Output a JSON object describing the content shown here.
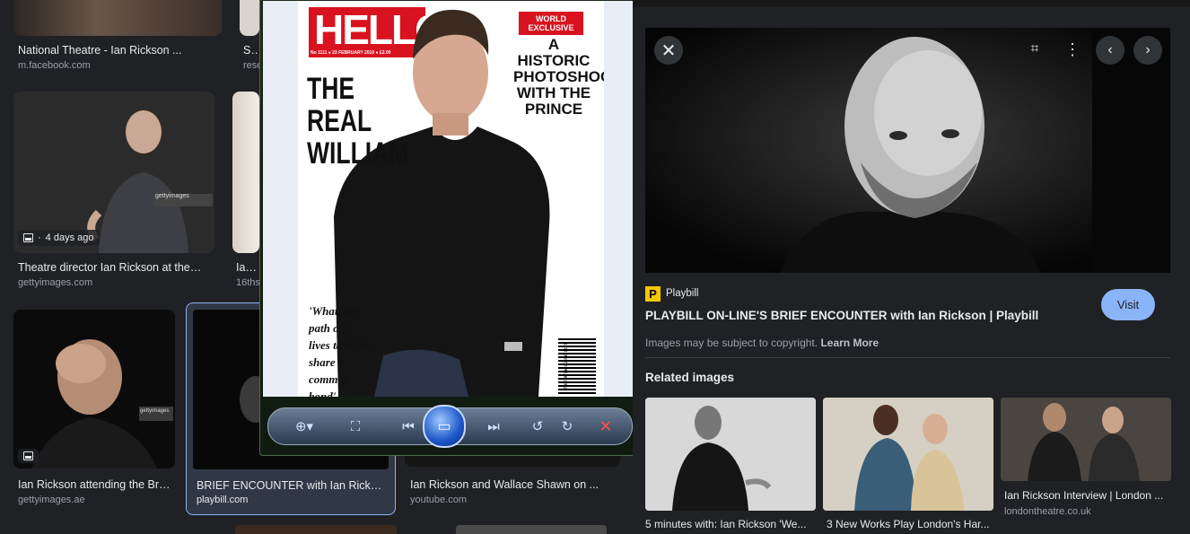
{
  "results": [
    {
      "title": "National Theatre - Ian Rickson ...",
      "source": "m.facebook.com"
    },
    {
      "title": "Sta",
      "source": "rese"
    },
    {
      "title": "Theatre director Ian Rickson at the ...",
      "source": "gettyimages.com",
      "badge": "4 days ago",
      "watermark": "gettyimages"
    },
    {
      "title": "Ian R",
      "source": "16ths"
    },
    {
      "title": "Ian Rickson attending the Bro...",
      "source": "gettyimages.ae",
      "watermark": "gettyimages"
    },
    {
      "title": "BRIEF ENCOUNTER with Ian Rickson...",
      "source": "playbill.com"
    },
    {
      "title": "Ian Rickson and Wallace Shawn on ...",
      "source": "youtube.com"
    }
  ],
  "viewer": {
    "magazine": {
      "masthead": "HELLO!",
      "issue": "No 1111 ● 23 FEBRUARY 2010 ● £2.00",
      "exclusive": "WORLD EXCLUSIVE",
      "headline": "THE REAL WILLIAM",
      "side_text": "A HISTORIC PHOTOSHOOT WITH THE PRINCE",
      "quote": "'Whatever path our lives take we share a common bond'",
      "barcode_text": "hellomagazine.com"
    }
  },
  "panel": {
    "site_name": "Playbill",
    "site_logo": "P",
    "title": "PLAYBILL ON-LINE'S BRIEF ENCOUNTER with Ian Rickson | Playbill",
    "copyright": "Images may be subject to copyright.",
    "learn_more": "Learn More",
    "visit_label": "Visit",
    "related_heading": "Related images",
    "related": [
      {
        "title": "5 minutes with: Ian Rickson 'We..."
      },
      {
        "title": "3 New Works Play London's Har..."
      },
      {
        "title": "Ian Rickson Interview | London ...",
        "source": "londontheatre.co.uk"
      }
    ]
  },
  "colors": {
    "background": "#202124",
    "accent": "#8ab4f8",
    "playbill_yellow": "#f6c700",
    "hello_red": "#d9121f"
  }
}
